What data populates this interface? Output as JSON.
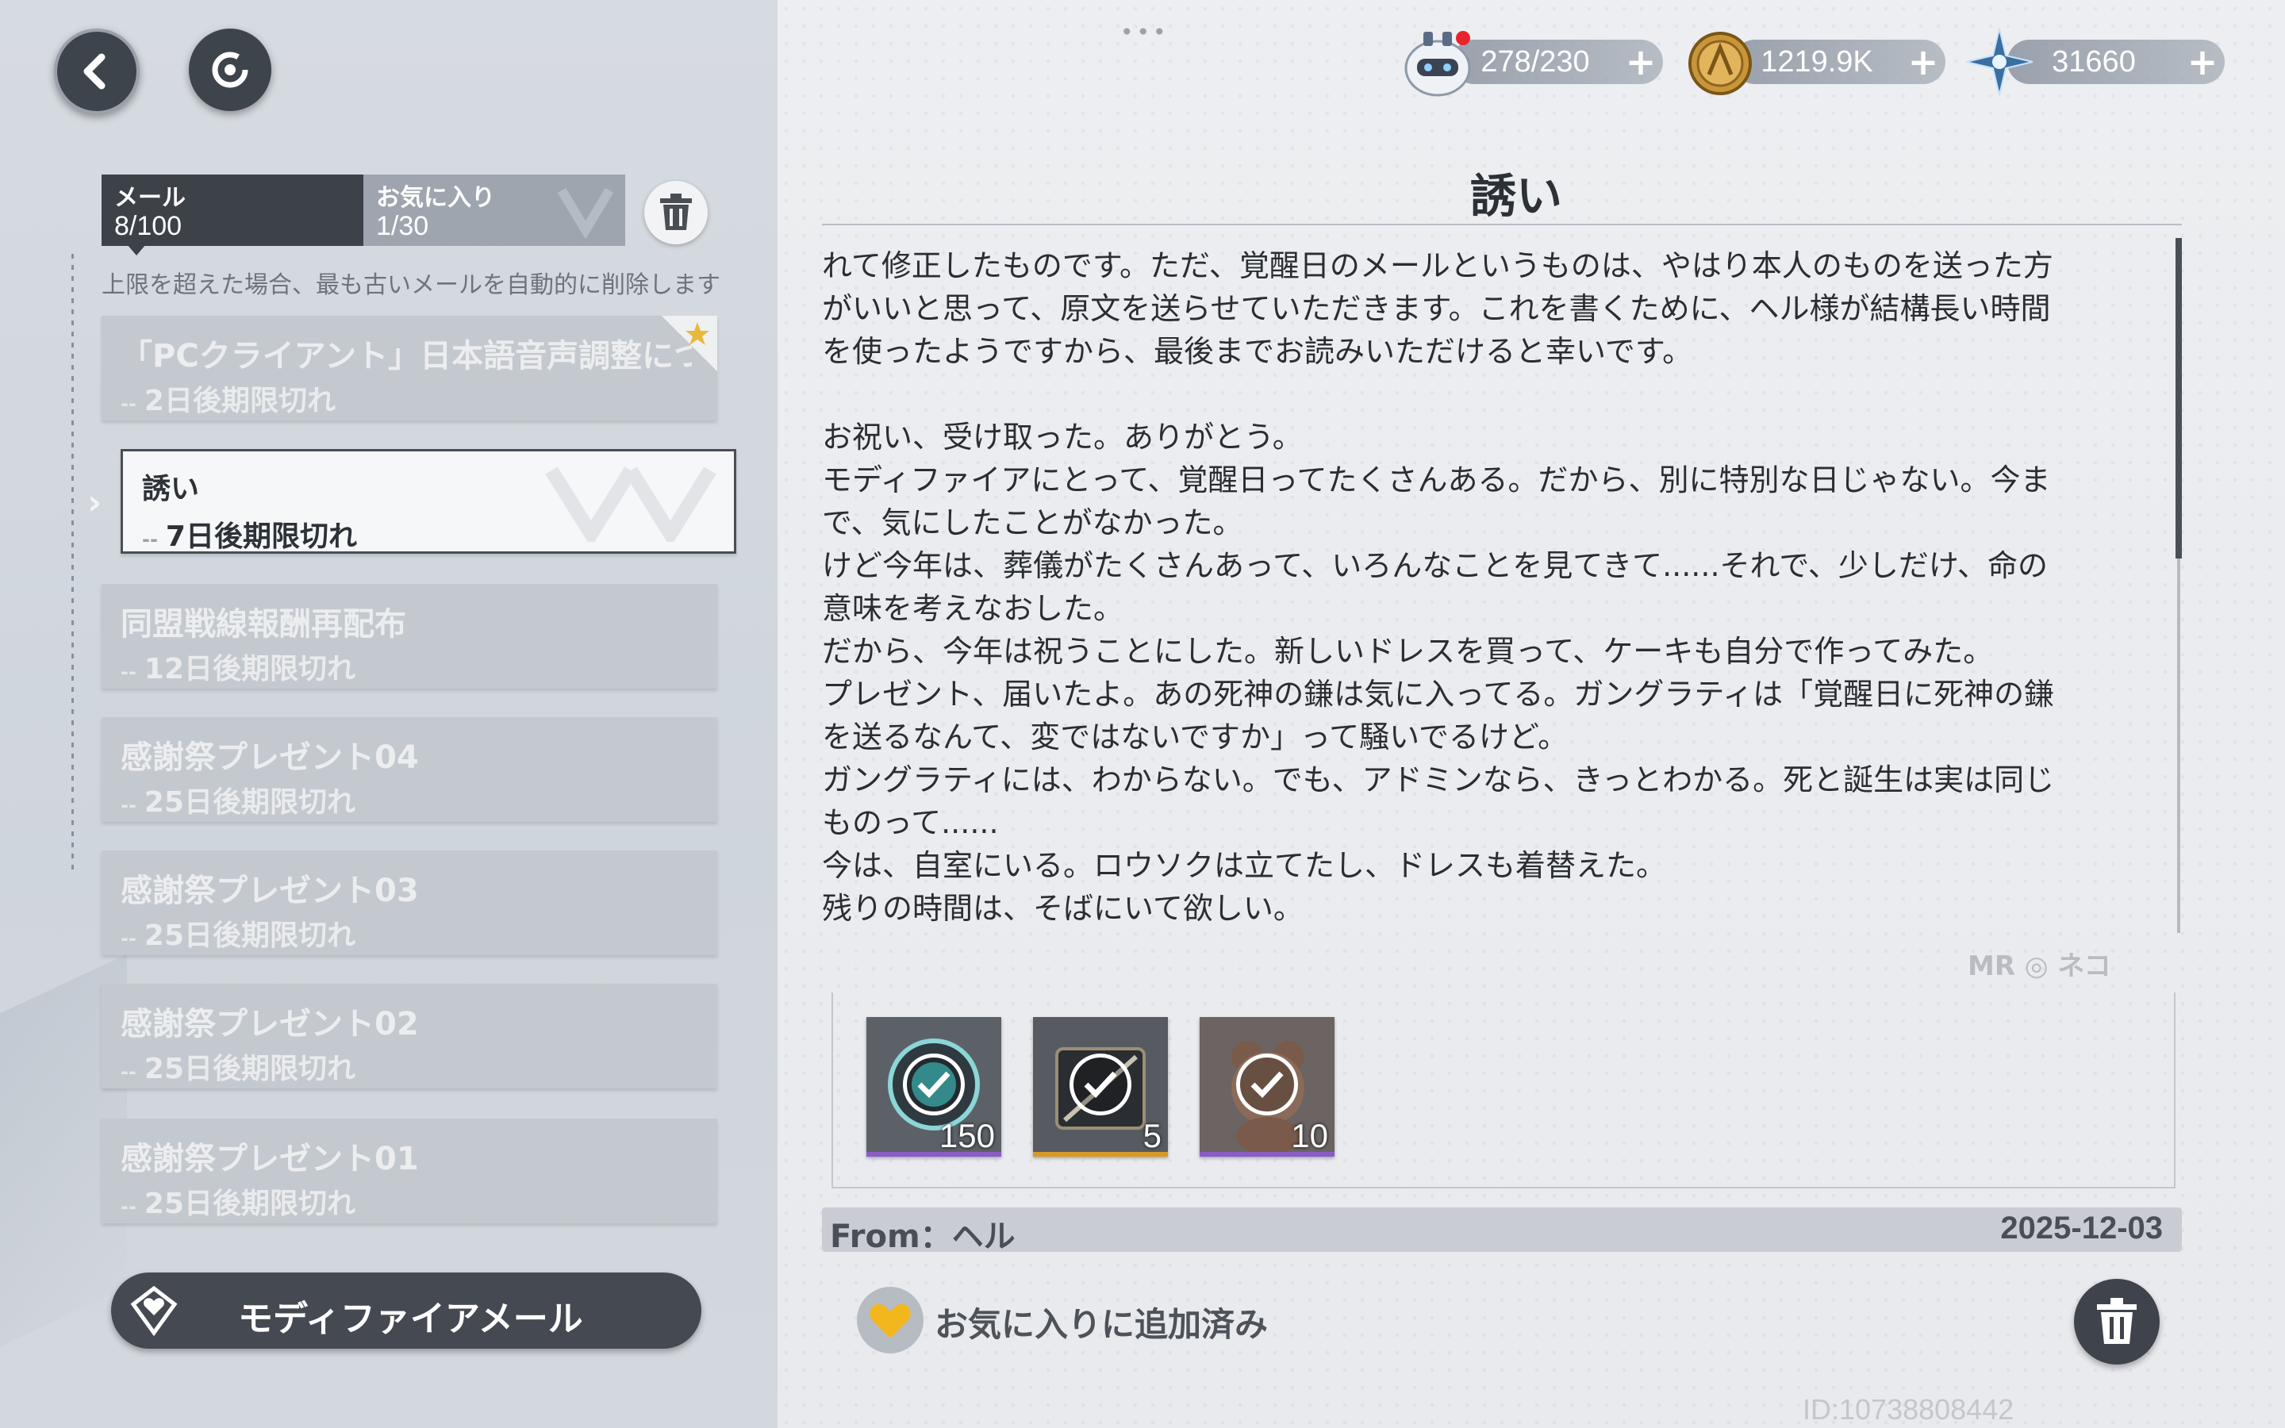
{
  "header": {
    "resources": [
      {
        "name": "stamina",
        "value": "278/230",
        "icon": "robot-helmet-icon"
      },
      {
        "name": "coins",
        "value": "1219.9K",
        "icon": "gold-coin-icon"
      },
      {
        "name": "crystals",
        "value": "31660",
        "icon": "star-crystal-icon"
      }
    ],
    "plus_label": "+",
    "drag_handle": "•••"
  },
  "sidebar": {
    "tabs": [
      {
        "label": "メール",
        "count": "8/100"
      },
      {
        "label": "お気に入り",
        "count": "1/30"
      }
    ],
    "notice": "上限を超えた場合、最も古いメールを自動的に削除します",
    "mails": [
      {
        "title": "「PCクライアント」日本語音声調整について",
        "expire": "2日後期限切れ",
        "favorite": true
      },
      {
        "title": "誘い",
        "expire": "7日後期限切れ",
        "selected": true
      },
      {
        "title": "同盟戦線報酬再配布",
        "expire": "12日後期限切れ"
      },
      {
        "title": "感謝祭プレゼント04",
        "expire": "25日後期限切れ"
      },
      {
        "title": "感謝祭プレゼント03",
        "expire": "25日後期限切れ"
      },
      {
        "title": "感謝祭プレゼント02",
        "expire": "25日後期限切れ"
      },
      {
        "title": "感謝祭プレゼント01",
        "expire": "25日後期限切れ"
      }
    ],
    "dash": "--",
    "modify_mail_label": "モディファイアメール"
  },
  "mail": {
    "title": "誘い",
    "body": "れて修正したものです。ただ、覚醒日のメールというものは、やはり本人のものを送った方\nがいいと思って、原文を送らせていただきます。これを書くために、ヘル様が結構長い時間\nを使ったようですから、最後までお読みいただけると幸いです。\n\nお祝い、受け取った。ありがとう。\nモディファイアにとって、覚醒日ってたくさんある。だから、別に特別な日じゃない。今ま\nで、気にしたことがなかった。\nけど今年は、葬儀がたくさんあって、いろんなことを見てきて......それで、少しだけ、命の\n意味を考えなおした。\nだから、今年は祝うことにした。新しいドレスを買って、ケーキも自分で作ってみた。\nプレゼント、届いたよ。あの死神の鎌は気に入ってる。ガングラティは「覚醒日に死神の鎌\nを送るなんて、変ではないですか」って騒いでるけど。\nガングラティには、わからない。でも、アドミンなら、きっとわかる。死と誕生は実は同じ\nものって......\n今は、自室にいる。ロウソクは立てたし、ドレスも着替えた。\n残りの時間は、そばにいて欲しい。",
    "attachments": [
      {
        "quantity": "150",
        "claimed": true,
        "rarity_color": "#8a5cc6",
        "icon": "gear-core-icon"
      },
      {
        "quantity": "5",
        "claimed": true,
        "rarity_color": "#d49a2a",
        "icon": "scythe-crate-icon"
      },
      {
        "quantity": "10",
        "claimed": true,
        "rarity_color": "#8a5cc6",
        "icon": "teddy-bear-icon"
      }
    ],
    "from": "From：ヘル",
    "date": "2025-12-03",
    "favorite_status": "お気に入りに追加済み",
    "brand_logos": "MR   ◎ ネコ"
  },
  "footer": {
    "user_id": "ID:10738808442"
  }
}
